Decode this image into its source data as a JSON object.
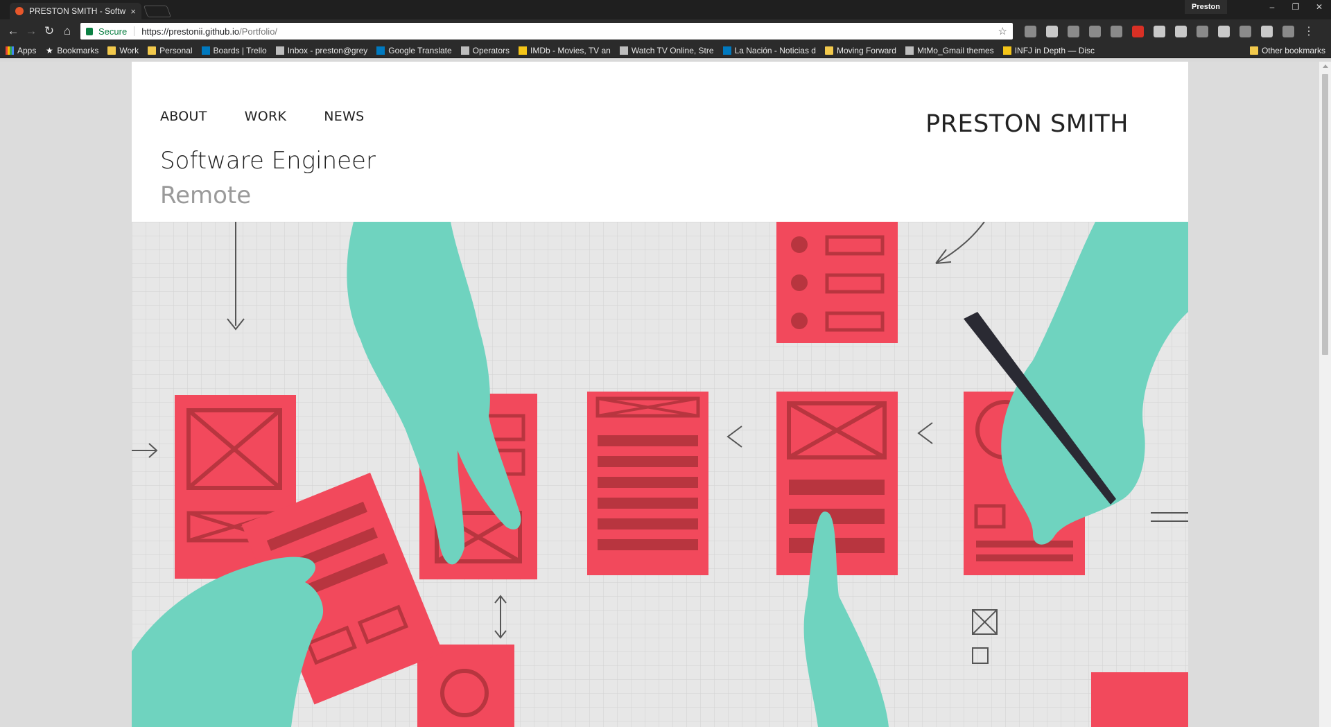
{
  "browser": {
    "tab_title": "PRESTON SMITH - Softw",
    "tab_close": "×",
    "profile": "Preston",
    "window_controls": [
      "‒",
      "❐",
      "✕"
    ],
    "nav": {
      "back": "←",
      "forward": "→",
      "reload": "↻",
      "home": "⌂"
    },
    "address": {
      "secure_label": "Secure",
      "host": "https://prestonii.github.io",
      "path": "/Portfolio/"
    },
    "star": "☆",
    "menu": "⋮"
  },
  "bookmarks": [
    {
      "label": "Apps",
      "icon": "grid"
    },
    {
      "label": "Bookmarks",
      "icon": "star2"
    },
    {
      "label": "Work",
      "icon": "folder"
    },
    {
      "label": "Personal",
      "icon": "folder"
    },
    {
      "label": "Boards | Trello",
      "icon": "blue"
    },
    {
      "label": "Inbox - preston@grey",
      "icon": "gray"
    },
    {
      "label": "Google Translate",
      "icon": "blue"
    },
    {
      "label": "Operators",
      "icon": "gray"
    },
    {
      "label": "IMDb - Movies, TV an",
      "icon": "imdb"
    },
    {
      "label": "Watch TV Online, Stre",
      "icon": "gray"
    },
    {
      "label": "La Nación - Noticias d",
      "icon": "blue"
    },
    {
      "label": "Moving Forward",
      "icon": "folder"
    },
    {
      "label": "MtMo_Gmail themes",
      "icon": "gray"
    },
    {
      "label": "INFJ in Depth — Disc",
      "icon": "imdb"
    }
  ],
  "other_bookmarks": "Other bookmarks",
  "site": {
    "nav": [
      "ABOUT",
      "WORK",
      "NEWS"
    ],
    "role": "Software Engineer",
    "location": "Remote",
    "brand": "PRESTON SMITH"
  },
  "colors": {
    "card": "#f2495c",
    "hand": "#6fd3bf",
    "ink": "#2a2a33",
    "paper": "#e7e7e7"
  }
}
